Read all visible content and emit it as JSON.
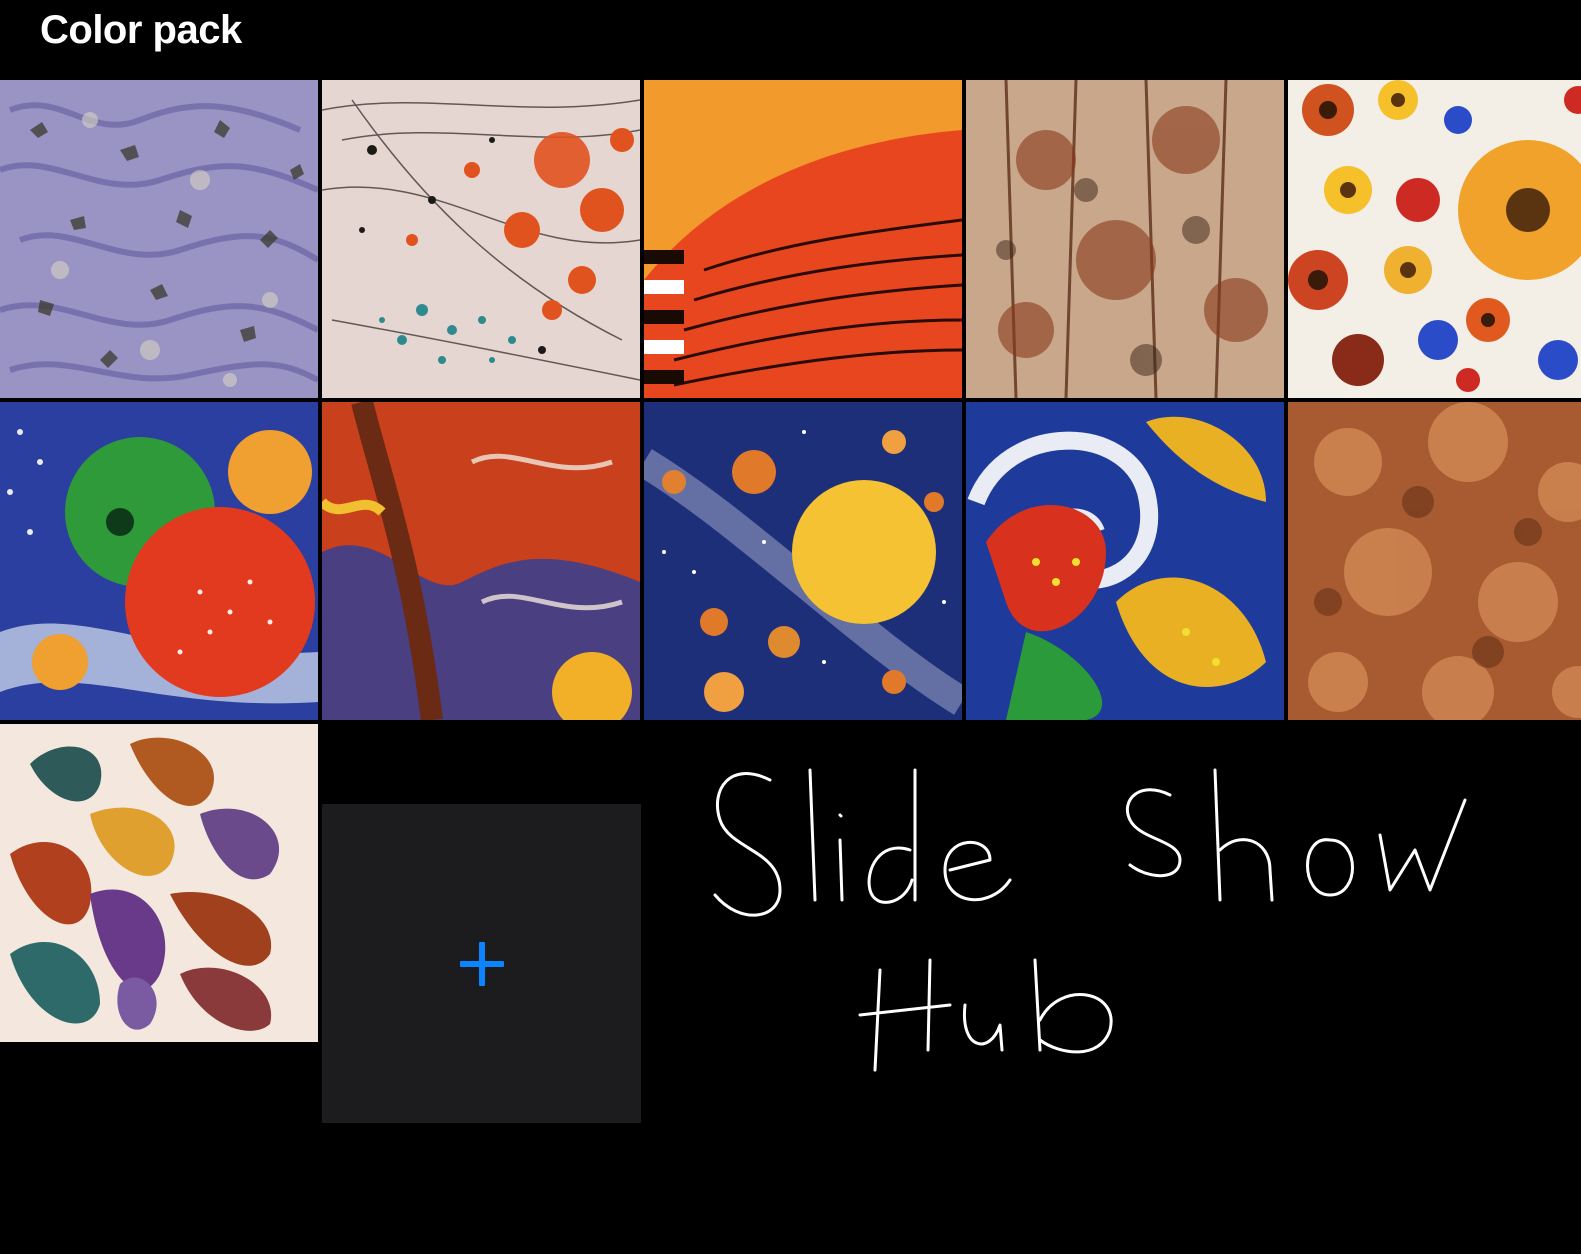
{
  "header": {
    "title": "Color pack"
  },
  "artworks": [
    {
      "icon": "artwork-thumbnail",
      "theme": "lavender-marble"
    },
    {
      "icon": "artwork-thumbnail",
      "theme": "orange-splatter"
    },
    {
      "icon": "artwork-thumbnail",
      "theme": "red-feather"
    },
    {
      "icon": "artwork-thumbnail",
      "theme": "sepia-forest"
    },
    {
      "icon": "artwork-thumbnail",
      "theme": "flower-collage"
    },
    {
      "icon": "artwork-thumbnail",
      "theme": "dotted-planets"
    },
    {
      "icon": "artwork-thumbnail",
      "theme": "red-blue-flow"
    },
    {
      "icon": "artwork-thumbnail",
      "theme": "solar-system"
    },
    {
      "icon": "artwork-thumbnail",
      "theme": "paisley-dots"
    },
    {
      "icon": "artwork-thumbnail",
      "theme": "brown-texture"
    },
    {
      "icon": "artwork-thumbnail",
      "theme": "paisley-drops"
    }
  ],
  "add_tile": {
    "icon": "plus-icon",
    "color": "#0a84ff",
    "background": "#1c1c1e"
  },
  "handwritten_note": {
    "line1": "Slide Show",
    "line2": "Hub",
    "color": "#ffffff"
  },
  "colors": {
    "background": "#000000",
    "title_text": "#ffffff"
  }
}
